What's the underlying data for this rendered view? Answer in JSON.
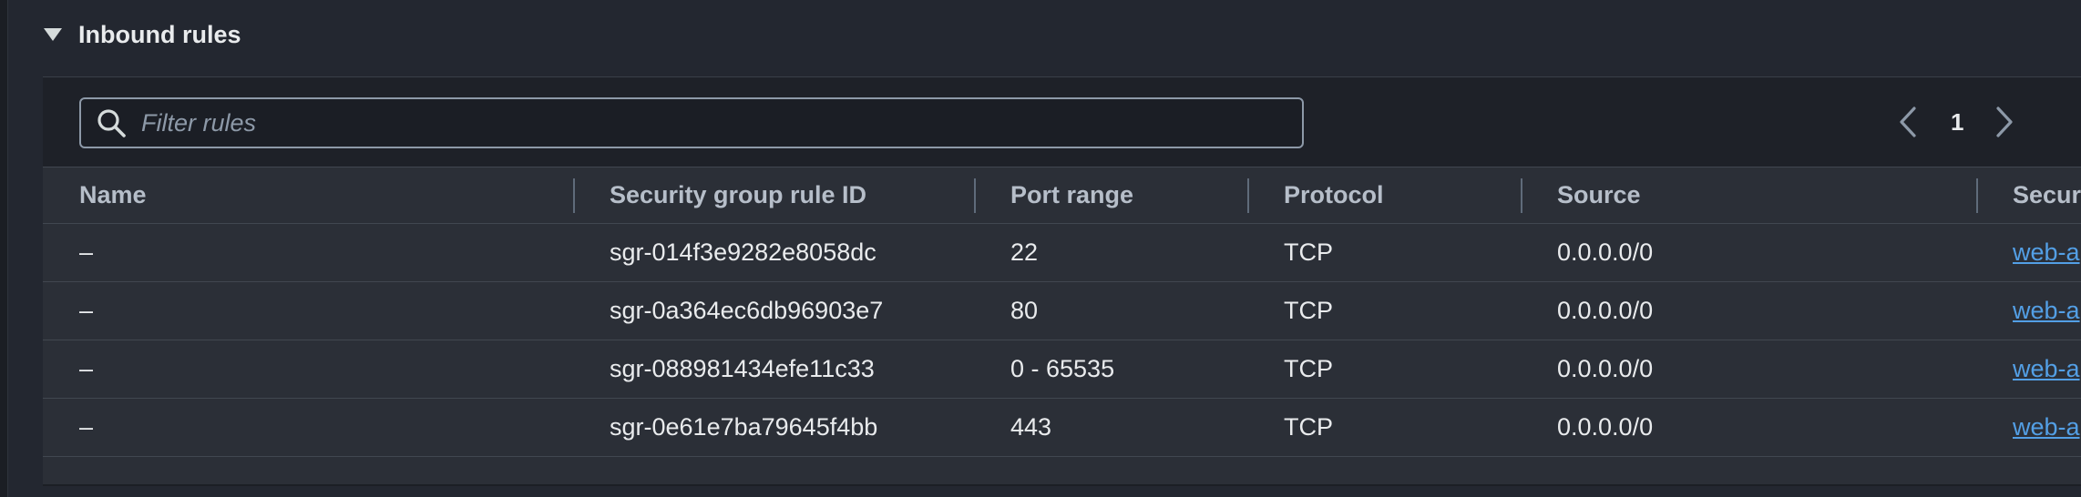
{
  "section": {
    "title": "Inbound rules"
  },
  "filter": {
    "placeholder": "Filter rules",
    "value": ""
  },
  "pagination": {
    "current_page": "1"
  },
  "icons": {
    "search": "search-icon",
    "prev": "chevron-left-icon",
    "next": "chevron-right-icon",
    "toggle": "caret-down-icon"
  },
  "colors": {
    "link": "#539fe5",
    "background": "#232730",
    "panel": "#2b2f37"
  },
  "table": {
    "columns": [
      "Name",
      "Security group rule ID",
      "Port range",
      "Protocol",
      "Source",
      "Secur"
    ],
    "rows": [
      {
        "name": "–",
        "rule_id": "sgr-014f3e9282e8058dc",
        "port_range": "22",
        "protocol": "TCP",
        "source": "0.0.0.0/0",
        "security_group": "web-a"
      },
      {
        "name": "–",
        "rule_id": "sgr-0a364ec6db96903e7",
        "port_range": "80",
        "protocol": "TCP",
        "source": "0.0.0.0/0",
        "security_group": "web-a"
      },
      {
        "name": "–",
        "rule_id": "sgr-088981434efe11c33",
        "port_range": "0 - 65535",
        "protocol": "TCP",
        "source": "0.0.0.0/0",
        "security_group": "web-a"
      },
      {
        "name": "–",
        "rule_id": "sgr-0e61e7ba79645f4bb",
        "port_range": "443",
        "protocol": "TCP",
        "source": "0.0.0.0/0",
        "security_group": "web-a"
      }
    ]
  }
}
